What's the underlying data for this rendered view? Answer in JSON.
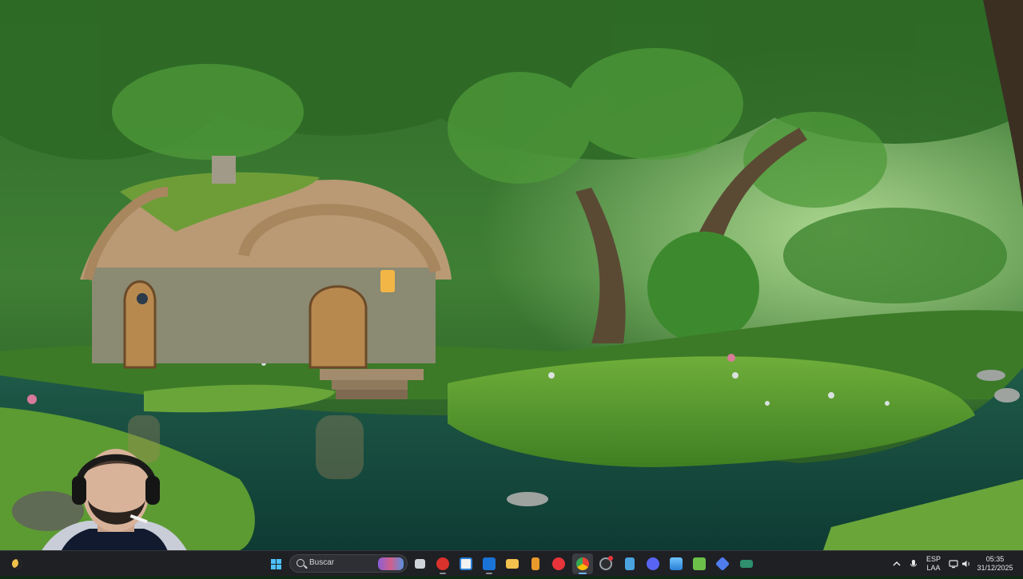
{
  "taskbar": {
    "widget_icon": "moon-weather-icon",
    "search": {
      "placeholder": "Buscar"
    },
    "pinned": [
      {
        "name": "start-button",
        "icon": "windows-logo-icon",
        "color": "#4cc2ff"
      },
      {
        "name": "task-view-button",
        "icon": "task-view-icon",
        "color": "#cfd3da"
      },
      {
        "name": "app-red-button",
        "icon": "red-app-icon",
        "color": "#d9312b"
      },
      {
        "name": "store-button",
        "icon": "store-icon",
        "color": "#f2f2f2"
      },
      {
        "name": "outlook-button",
        "icon": "outlook-icon",
        "color": "#1a73d6"
      },
      {
        "name": "file-explorer-button",
        "icon": "folder-icon",
        "color": "#f2c14e"
      },
      {
        "name": "app-orange-button",
        "icon": "orange-app-icon",
        "color": "#e89a2c"
      },
      {
        "name": "media-player-button",
        "icon": "play-icon",
        "color": "#e8343a"
      },
      {
        "name": "chrome-button",
        "icon": "chrome-icon",
        "color": "#34a853"
      },
      {
        "name": "app-dark-button",
        "icon": "dark-app-icon",
        "color": "#9aa0a6"
      },
      {
        "name": "notepad-button",
        "icon": "notepad-icon",
        "color": "#4aa3df"
      },
      {
        "name": "discord-button",
        "icon": "discord-icon",
        "color": "#5865f2"
      },
      {
        "name": "photos-button",
        "icon": "photos-icon",
        "color": "#3e9be0"
      },
      {
        "name": "android-app-button",
        "icon": "android-icon",
        "color": "#6cc04a"
      },
      {
        "name": "app-blue-button",
        "icon": "blue-app-icon",
        "color": "#4f7df0"
      },
      {
        "name": "app-green-button",
        "icon": "green-app-icon",
        "color": "#2f8f6f"
      }
    ],
    "tray": {
      "language_top": "ESP",
      "language_bottom": "LAA",
      "time": "05:35",
      "date": "31/12/2025"
    }
  },
  "colors": {
    "taskbar_bg": "#1f2024",
    "accent": "#6fb8ff"
  }
}
